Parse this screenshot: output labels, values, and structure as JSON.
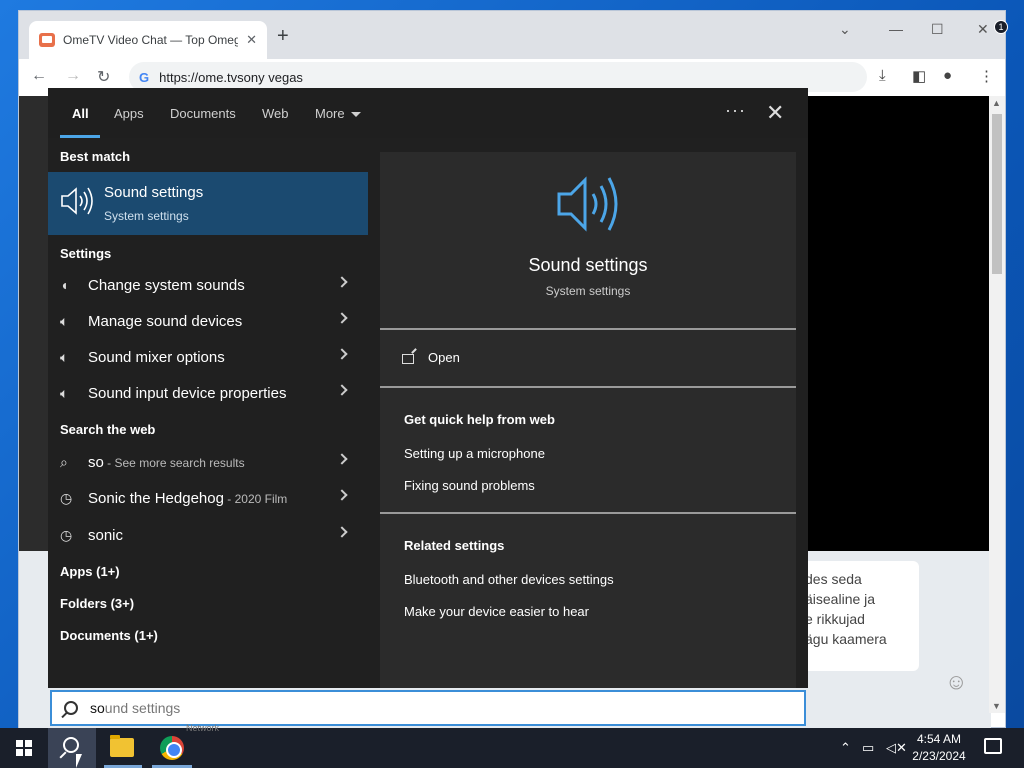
{
  "browser": {
    "tab_title": "OmeTV Video Chat — Top Omeg",
    "tab_close": "✕",
    "new_tab": "+",
    "url": "https://ome.tvsony vegas",
    "g_letter": "G"
  },
  "chat": {
    "lines": [
      "des seda",
      "äisealine ja",
      "e rikkujad",
      "ägu kaamera"
    ]
  },
  "filters": {
    "all": "All",
    "apps": "Apps",
    "documents": "Documents",
    "web": "Web",
    "more": "More",
    "ellipsis": "···",
    "close": "✕"
  },
  "best_match": {
    "header": "Best match",
    "title": "Sound settings",
    "subtitle": "System settings"
  },
  "settings": {
    "header": "Settings",
    "items": [
      {
        "label": "Change system sounds"
      },
      {
        "label": "Manage sound devices"
      },
      {
        "label": "Sound mixer options"
      },
      {
        "label": "Sound input device properties"
      }
    ]
  },
  "web": {
    "header": "Search the web",
    "items": [
      {
        "label": "so",
        "sub": " - See more search results"
      },
      {
        "label": "Sonic the Hedgehog",
        "sub": " - 2020 Film"
      },
      {
        "label": "sonic",
        "sub": ""
      }
    ]
  },
  "groups": {
    "apps": "Apps (1+)",
    "folders": "Folders (3+)",
    "documents": "Documents (1+)"
  },
  "preview": {
    "title": "Sound settings",
    "subtitle": "System settings",
    "open": "Open",
    "quick_help_header": "Get quick help from web",
    "quick_help": [
      "Setting up a microphone",
      "Fixing sound problems"
    ],
    "related_header": "Related settings",
    "related": [
      "Bluetooth and other devices settings",
      "Make your device easier to hear"
    ]
  },
  "search_box": {
    "typed": "so",
    "suggestion": "und settings"
  },
  "taskbar": {
    "network_label": "Network",
    "clock_time": "4:54 AM",
    "clock_date": "2/23/2024",
    "notification_count": "1"
  },
  "colors": {
    "accent": "#4ca6e8",
    "best_match_bg": "#1b4a70",
    "panel_bg": "#202020"
  }
}
